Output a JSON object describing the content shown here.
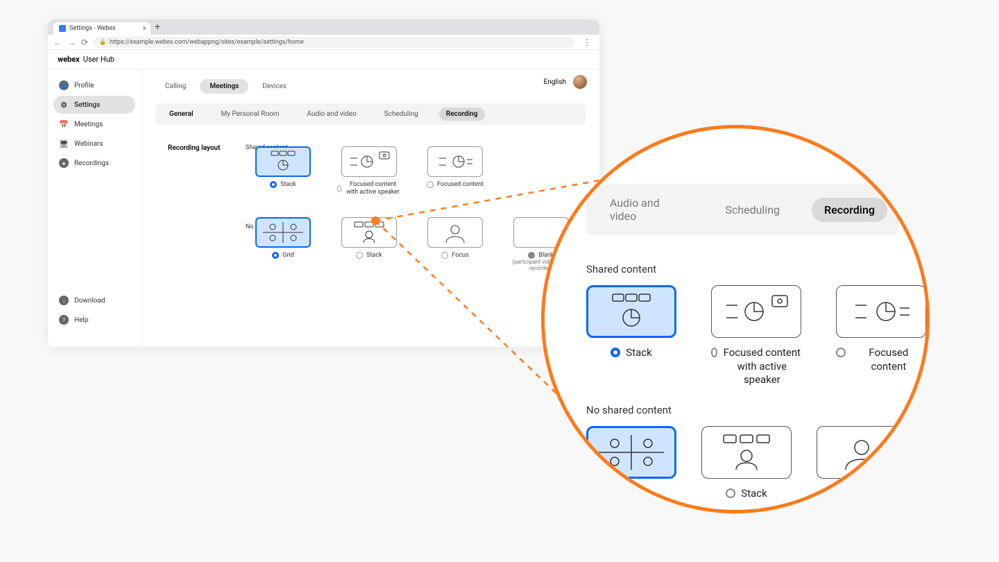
{
  "browser": {
    "tab_title": "Settings - Webex",
    "url": "https://example.webex.com/webappng/sites/example/settings/home"
  },
  "app": {
    "brand": "webex",
    "product": "User Hub",
    "language": "English"
  },
  "sidebar": {
    "items": [
      {
        "label": "Profile"
      },
      {
        "label": "Settings"
      },
      {
        "label": "Meetings"
      },
      {
        "label": "Webinars"
      },
      {
        "label": "Recordings"
      }
    ],
    "footer": [
      {
        "label": "Download"
      },
      {
        "label": "Help"
      }
    ]
  },
  "tabs_primary": [
    {
      "label": "Calling"
    },
    {
      "label": "Meetings"
    },
    {
      "label": "Devices"
    }
  ],
  "tabs_secondary": [
    {
      "label": "General"
    },
    {
      "label": "My Personal Room"
    },
    {
      "label": "Audio and video"
    },
    {
      "label": "Scheduling"
    },
    {
      "label": "Recording"
    }
  ],
  "recording": {
    "panel_title": "Recording layout",
    "shared_header": "Shared content",
    "no_shared_header": "No shared content",
    "shared_options": [
      {
        "label": "Stack"
      },
      {
        "label": "Focused content with active speaker"
      },
      {
        "label": "Focused content"
      }
    ],
    "no_shared_options": [
      {
        "label": "Grid"
      },
      {
        "label": "Stack"
      },
      {
        "label": "Focus"
      },
      {
        "label": "Blank"
      }
    ],
    "blank_hint": "(participant video is not recorded)"
  },
  "zoom": {
    "subtabs": [
      {
        "label": "Audio and video"
      },
      {
        "label": "Scheduling"
      },
      {
        "label": "Recording"
      }
    ],
    "shared_header": "Shared content",
    "no_shared_header": "No shared content",
    "shared_options": [
      {
        "label": "Stack"
      },
      {
        "label": "Focused content with active speaker"
      },
      {
        "label": "Focused content"
      }
    ],
    "no_shared_options": [
      {
        "label": "Grid"
      },
      {
        "label": "Stack"
      },
      {
        "label": "Focus"
      }
    ]
  }
}
